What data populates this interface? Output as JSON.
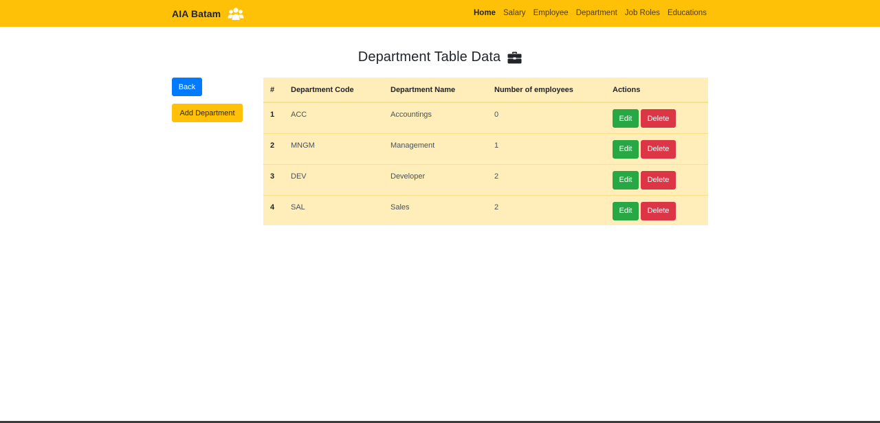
{
  "header": {
    "brand": "AIA Batam",
    "brand_icon": "users-icon",
    "nav": [
      "Home",
      "Salary",
      "Employee",
      "Department",
      "Job Roles",
      "Educations"
    ],
    "active_nav": "Home",
    "bg_color": "#ffc107"
  },
  "page": {
    "title": "Department Table Data",
    "title_icon": "briefcase-icon"
  },
  "sidebar": {
    "back_label": "Back",
    "add_label": "Add Department"
  },
  "table": {
    "columns": [
      "#",
      "Department Code",
      "Department Name",
      "Number of employees",
      "Actions"
    ],
    "rows": [
      {
        "num": "1",
        "code": "ACC",
        "name": "Accountings",
        "employees": "0"
      },
      {
        "num": "2",
        "code": "MNGM",
        "name": "Management",
        "employees": "1"
      },
      {
        "num": "3",
        "code": "DEV",
        "name": "Developer",
        "employees": "2"
      },
      {
        "num": "4",
        "code": "SAL",
        "name": "Sales",
        "employees": "2"
      }
    ],
    "edit_label": "Edit",
    "delete_label": "Delete",
    "colors": {
      "edit": "#28a745",
      "delete": "#dc3545",
      "table_bg": "#ffeeba"
    }
  }
}
